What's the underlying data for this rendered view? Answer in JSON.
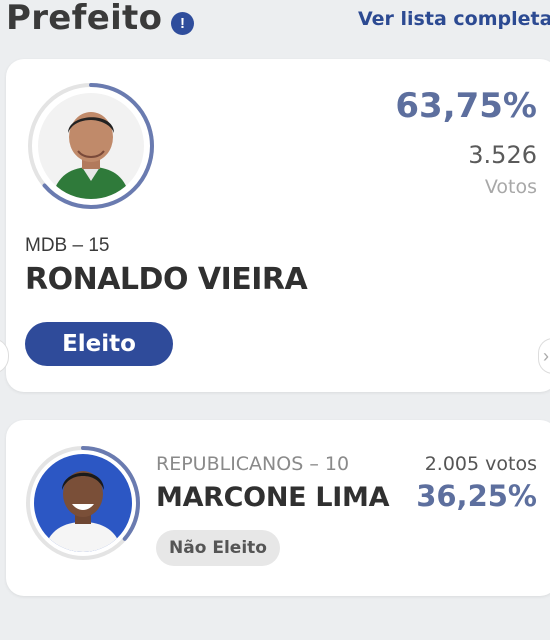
{
  "header": {
    "title": "Prefeito",
    "info_icon": "info-icon",
    "list_link": "Ver lista completa"
  },
  "candidates": [
    {
      "party": "MDB – 15",
      "name": "RONALDO VIEIRA",
      "percent": "63,75%",
      "votes": "3.526",
      "votes_label": "Votos",
      "status": "Eleito",
      "vote_share": 0.6375
    },
    {
      "party": "REPUBLICANOS – 10",
      "name": "MARCONE LIMA",
      "percent": "36,25%",
      "votes": "2.005 votos",
      "status": "Não Eleito",
      "vote_share": 0.3625
    }
  ],
  "carousel": {
    "prev_icon": "chevron-left-icon",
    "next_icon": "chevron-right-icon"
  },
  "colors": {
    "accent": "#2f4b9a",
    "percent": "#5d6f9e",
    "ring": "#6a7bb0",
    "ring_track": "#e4e4e4"
  }
}
